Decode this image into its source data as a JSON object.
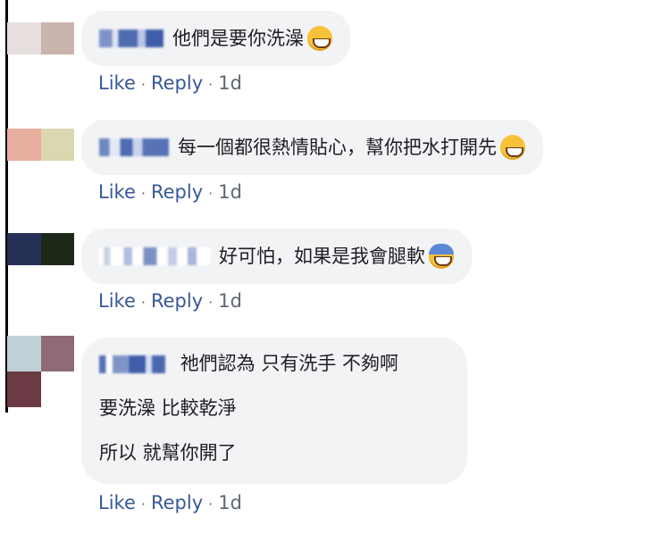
{
  "colors": {
    "bubble_bg": "#f2f3f5",
    "link": "#385898",
    "meta": "#606770",
    "thread_line": "#000000"
  },
  "actions": {
    "like": "Like",
    "reply": "Reply",
    "separator": "·"
  },
  "comments": [
    {
      "lines": [
        "他們是要你洗澡"
      ],
      "emoji": "grinning-face-icon",
      "time": "1d",
      "avatar_colors": [
        "#e7dede",
        "#cbb3ae"
      ]
    },
    {
      "lines": [
        "每一個都很熱情貼心，幫你把水打開先"
      ],
      "emoji": "grinning-face-icon",
      "time": "1d",
      "avatar_colors": [
        "#e7aea0",
        "#dbd7b0"
      ]
    },
    {
      "lines": [
        "好可怕，如果是我會腿軟"
      ],
      "emoji": "anxious-face-icon",
      "time": "1d",
      "avatar_colors": [
        "#273057",
        "#1c2918"
      ]
    },
    {
      "lines": [
        "祂們認為 只有洗手 不夠啊",
        "要洗澡 比較乾淨",
        "所以 就幫你開了"
      ],
      "emoji": "",
      "time": "1d",
      "avatar_colors": [
        "#bfd1d6",
        "#8e6b75",
        "#6b3a45",
        "#ffffff"
      ]
    }
  ]
}
